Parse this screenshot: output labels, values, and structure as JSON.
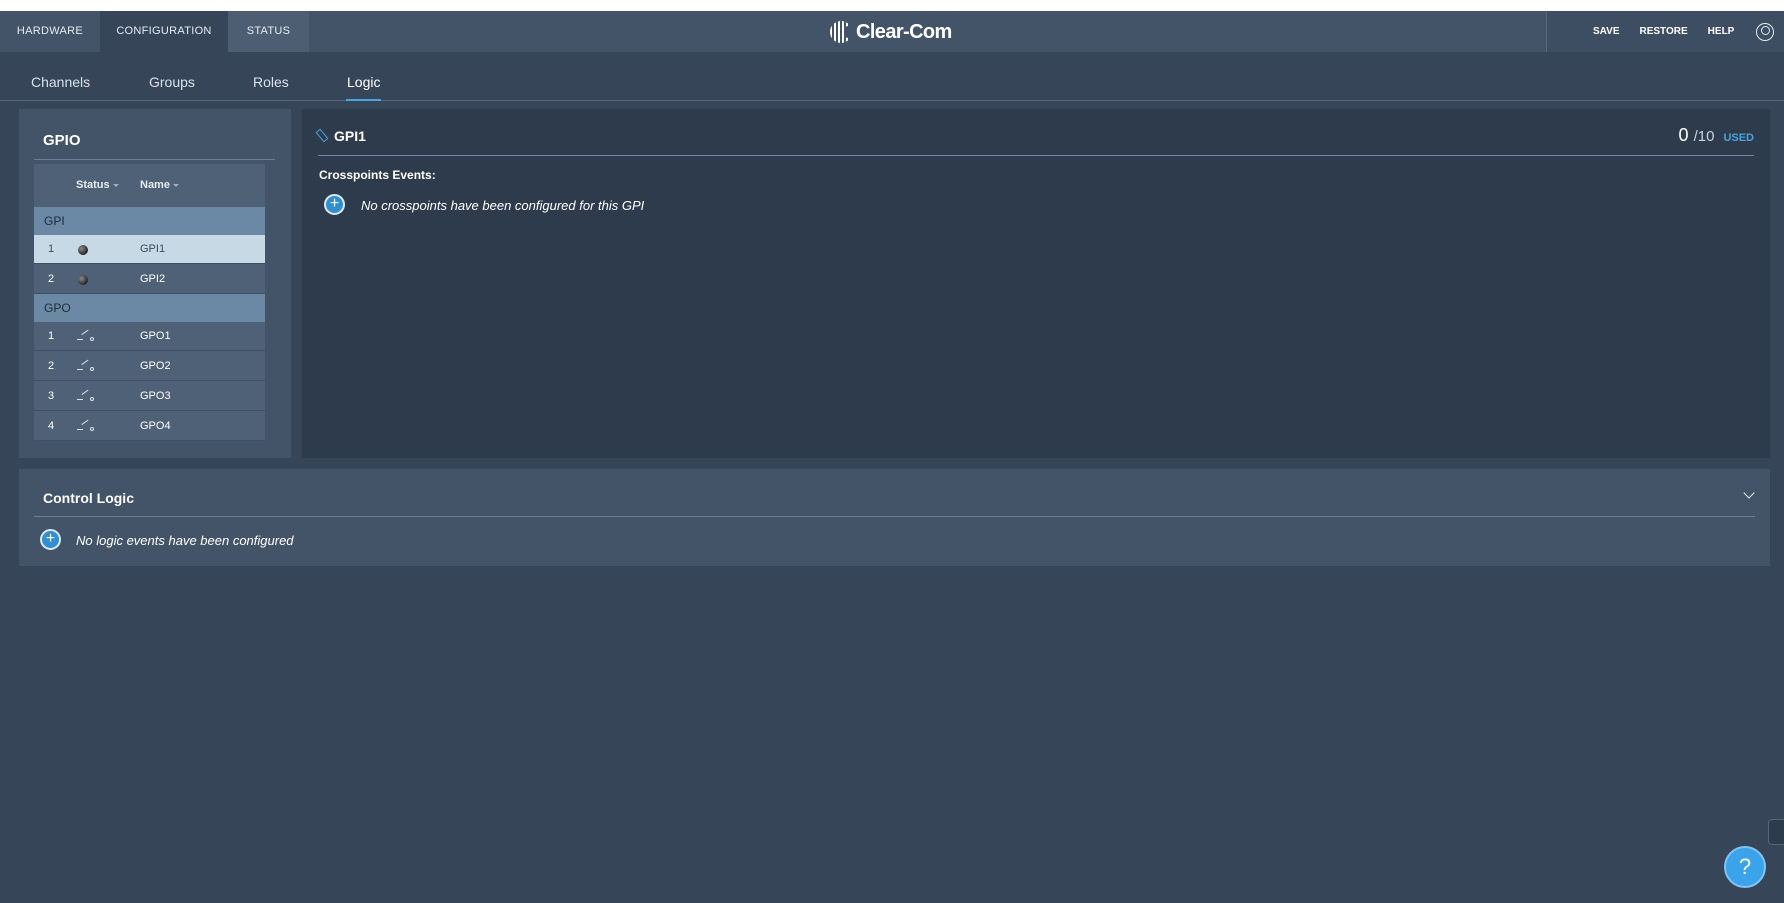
{
  "top_nav": {
    "tabs": [
      {
        "label": "HARDWARE"
      },
      {
        "label": "CONFIGURATION"
      },
      {
        "label": "STATUS"
      }
    ],
    "brand": "Clear-Com",
    "actions": {
      "save": "SAVE",
      "restore": "RESTORE",
      "help": "HELP"
    }
  },
  "sub_nav": {
    "tabs": [
      {
        "label": "Channels"
      },
      {
        "label": "Groups"
      },
      {
        "label": "Roles"
      },
      {
        "label": "Logic"
      }
    ],
    "active": "Logic"
  },
  "gpio": {
    "title": "GPIO",
    "columns": {
      "status": "Status",
      "name": "Name"
    },
    "gpi_group": "GPI",
    "gpo_group": "GPO",
    "gpi": [
      {
        "num": "1",
        "name": "GPI1"
      },
      {
        "num": "2",
        "name": "GPI2"
      }
    ],
    "gpo": [
      {
        "num": "1",
        "name": "GPO1"
      },
      {
        "num": "2",
        "name": "GPO2"
      },
      {
        "num": "3",
        "name": "GPO3"
      },
      {
        "num": "4",
        "name": "GPO4"
      }
    ]
  },
  "gpi_detail": {
    "title": "GPI1",
    "used": "0",
    "total": "/10",
    "used_label": "USED",
    "crosspoints_label": "Crosspoints Events:",
    "empty_message": "No crosspoints have been configured for this GPI"
  },
  "control_logic": {
    "title": "Control Logic",
    "empty_message": "No logic events have been configured"
  },
  "help_button": "?",
  "colors": {
    "accent": "#4aa3df",
    "background": "#364658",
    "panel": "#435468",
    "selected_row": "#c8d9e6"
  }
}
